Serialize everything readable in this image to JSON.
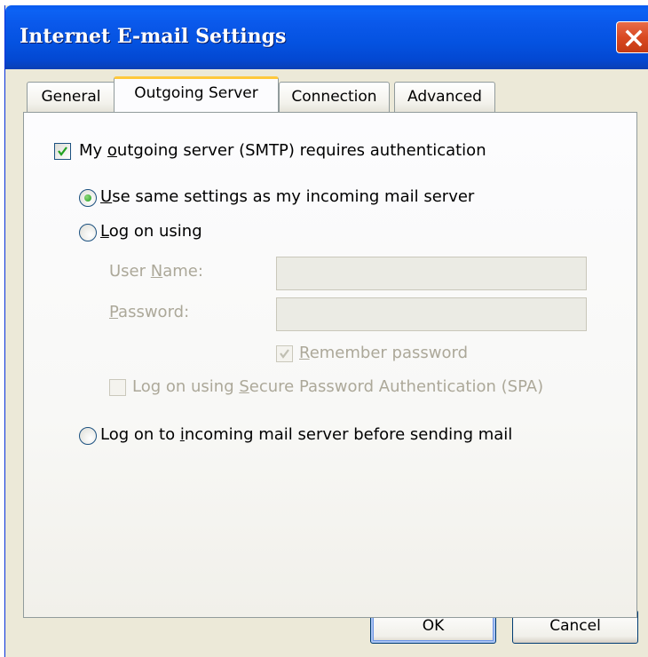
{
  "window": {
    "title": "Internet E-mail Settings"
  },
  "tabs": [
    {
      "label": "General",
      "active": false
    },
    {
      "label": "Outgoing Server",
      "active": true
    },
    {
      "label": "Connection",
      "active": false
    },
    {
      "label": "Advanced",
      "active": false
    }
  ],
  "auth": {
    "requires_auth": {
      "pre": "My ",
      "key": "o",
      "post": "utgoing server (SMTP) requires authentication",
      "checked": true
    },
    "use_same": {
      "pre": "",
      "key": "U",
      "post": "se same settings as my incoming mail server",
      "selected": true
    },
    "log_on_using": {
      "pre": "",
      "key": "L",
      "post": "og on using",
      "selected": false
    },
    "user_name": {
      "pre": "User ",
      "key": "N",
      "post": "ame:",
      "value": ""
    },
    "password": {
      "pre": "",
      "key": "P",
      "post": "assword:",
      "value": ""
    },
    "remember": {
      "pre": "",
      "key": "R",
      "post": "emember password",
      "checked": true
    },
    "spa": {
      "pre": "Log on using ",
      "key": "S",
      "post": "ecure Password Authentication (SPA)",
      "checked": false
    },
    "log_on_incoming": {
      "pre": "Log on to ",
      "key": "i",
      "post": "ncoming mail server before sending mail",
      "selected": false
    }
  },
  "buttons": {
    "ok": "OK",
    "cancel": "Cancel"
  },
  "colors": {
    "titlebar": "#0a58ea",
    "dialog_bg": "#ece9d8",
    "tab_highlight": "#ffc83c",
    "radio_dot": "#21a121"
  }
}
